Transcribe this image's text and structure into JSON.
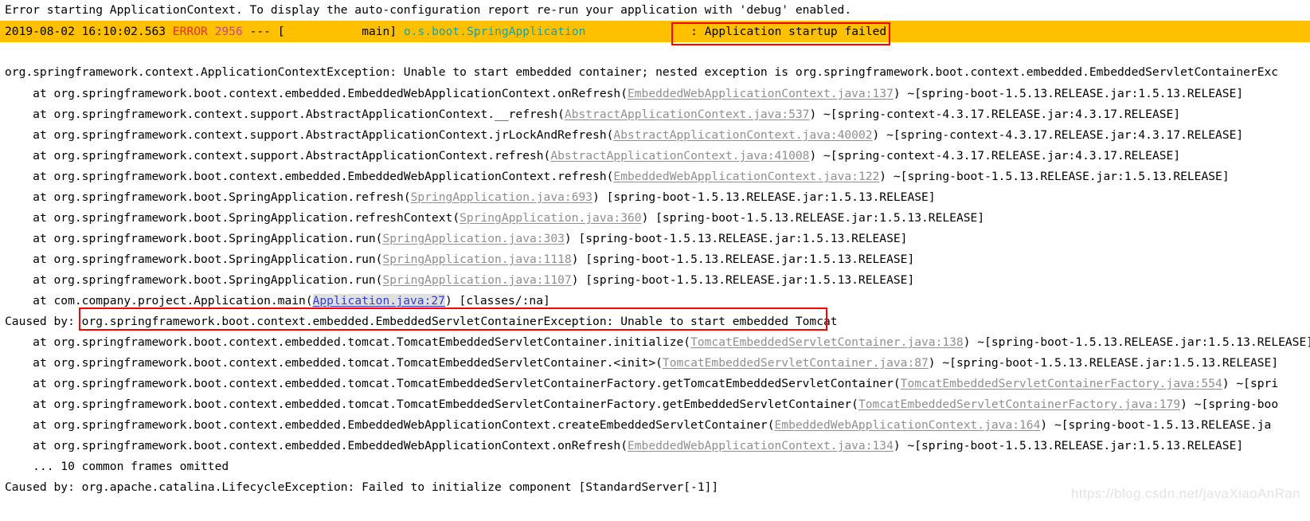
{
  "window": {
    "type": "console-log-output",
    "background_color": "#ffffff",
    "text_color": "#000000",
    "banner_color": "#ffc000",
    "annotation_color": "#ff0000",
    "link_color": "#8f8f8f",
    "link_active_color": "#2a3fd4"
  },
  "header": {
    "message": "Error starting ApplicationContext. To display the auto-configuration report re-run your application with 'debug' enabled."
  },
  "log_entry": {
    "timestamp": "2019-08-02 16:10:02.563",
    "level": "ERROR",
    "pid": "2956",
    "separator": "---",
    "thread_open": "[",
    "thread": "main]",
    "logger": "o.s.boot.SpringApplication",
    "message": ": Application startup failed"
  },
  "annotations": [
    {
      "id": "startup-failed-box",
      "label": ": Application startup failed"
    },
    {
      "id": "embedded-tomcat-box",
      "label": "org.springframework.boot.context.embedded.EmbeddedServletContainerException: Unable to start embedded Tomcat"
    }
  ],
  "exception_header": "org.springframework.context.ApplicationContextException: Unable to start embedded container; nested exception is org.springframework.boot.context.embedded.EmbeddedServletContainerExc",
  "stack_lines": [
    {
      "indent": "    ",
      "prefix": "at org.springframework.boot.context.embedded.EmbeddedWebApplicationContext.onRefresh(",
      "link": "EmbeddedWebApplicationContext.java:137",
      "suffix": ") ~[spring-boot-1.5.13.RELEASE.jar:1.5.13.RELEASE]"
    },
    {
      "indent": "    ",
      "prefix": "at org.springframework.context.support.AbstractApplicationContext.__refresh(",
      "link": "AbstractApplicationContext.java:537",
      "suffix": ") ~[spring-context-4.3.17.RELEASE.jar:4.3.17.RELEASE]"
    },
    {
      "indent": "    ",
      "prefix": "at org.springframework.context.support.AbstractApplicationContext.jrLockAndRefresh(",
      "link": "AbstractApplicationContext.java:40002",
      "suffix": ") ~[spring-context-4.3.17.RELEASE.jar:4.3.17.RELEASE]"
    },
    {
      "indent": "    ",
      "prefix": "at org.springframework.context.support.AbstractApplicationContext.refresh(",
      "link": "AbstractApplicationContext.java:41008",
      "suffix": ") ~[spring-context-4.3.17.RELEASE.jar:4.3.17.RELEASE]"
    },
    {
      "indent": "    ",
      "prefix": "at org.springframework.boot.context.embedded.EmbeddedWebApplicationContext.refresh(",
      "link": "EmbeddedWebApplicationContext.java:122",
      "suffix": ") ~[spring-boot-1.5.13.RELEASE.jar:1.5.13.RELEASE]"
    },
    {
      "indent": "    ",
      "prefix": "at org.springframework.boot.SpringApplication.refresh(",
      "link": "SpringApplication.java:693",
      "suffix": ") [spring-boot-1.5.13.RELEASE.jar:1.5.13.RELEASE]"
    },
    {
      "indent": "    ",
      "prefix": "at org.springframework.boot.SpringApplication.refreshContext(",
      "link": "SpringApplication.java:360",
      "suffix": ") [spring-boot-1.5.13.RELEASE.jar:1.5.13.RELEASE]"
    },
    {
      "indent": "    ",
      "prefix": "at org.springframework.boot.SpringApplication.run(",
      "link": "SpringApplication.java:303",
      "suffix": ") [spring-boot-1.5.13.RELEASE.jar:1.5.13.RELEASE]"
    },
    {
      "indent": "    ",
      "prefix": "at org.springframework.boot.SpringApplication.run(",
      "link": "SpringApplication.java:1118",
      "suffix": ") [spring-boot-1.5.13.RELEASE.jar:1.5.13.RELEASE]"
    },
    {
      "indent": "    ",
      "prefix": "at org.springframework.boot.SpringApplication.run(",
      "link": "SpringApplication.java:1107",
      "suffix": ") [spring-boot-1.5.13.RELEASE.jar:1.5.13.RELEASE]"
    }
  ],
  "selected_line": {
    "indent": "    ",
    "prefix": "at com.company.project.Application.main(",
    "link_part1": "Application.",
    "link_part2": "java:27",
    "suffix": ") [classes/:na]"
  },
  "caused_by_1": {
    "label": "Caused by: ",
    "message": "org.springframework.boot.context.embedded.EmbeddedServletContainerException: Unable to start embedded Tomcat"
  },
  "stack_lines_2": [
    {
      "indent": "    ",
      "prefix": "at org.springframework.boot.context.embedded.tomcat.TomcatEmbeddedServletContainer.initialize(",
      "link": "TomcatEmbeddedServletContainer.java:138",
      "suffix": ") ~[spring-boot-1.5.13.RELEASE.jar:1.5.13.RELEASE]"
    },
    {
      "indent": "    ",
      "prefix": "at org.springframework.boot.context.embedded.tomcat.TomcatEmbeddedServletContainer.<init>(",
      "link": "TomcatEmbeddedServletContainer.java:87",
      "suffix": ") ~[spring-boot-1.5.13.RELEASE.jar:1.5.13.RELEASE]"
    },
    {
      "indent": "    ",
      "prefix": "at org.springframework.boot.context.embedded.tomcat.TomcatEmbeddedServletContainerFactory.getTomcatEmbeddedServletContainer(",
      "link": "TomcatEmbeddedServletContainerFactory.java:554",
      "suffix": ") ~[spri"
    },
    {
      "indent": "    ",
      "prefix": "at org.springframework.boot.context.embedded.tomcat.TomcatEmbeddedServletContainerFactory.getEmbeddedServletContainer(",
      "link": "TomcatEmbeddedServletContainerFactory.java:179",
      "suffix": ") ~[spring-boo"
    },
    {
      "indent": "    ",
      "prefix": "at org.springframework.boot.context.embedded.EmbeddedWebApplicationContext.createEmbeddedServletContainer(",
      "link": "EmbeddedWebApplicationContext.java:164",
      "suffix": ") ~[spring-boot-1.5.13.RELEASE.ja"
    },
    {
      "indent": "    ",
      "prefix": "at org.springframework.boot.context.embedded.EmbeddedWebApplicationContext.onRefresh(",
      "link": "EmbeddedWebApplicationContext.java:134",
      "suffix": ") ~[spring-boot-1.5.13.RELEASE.jar:1.5.13.RELEASE]"
    }
  ],
  "omitted_frames": "    ... 10 common frames omitted",
  "caused_by_2": {
    "label": "Caused by: ",
    "message": "org.apache.catalina.LifecycleException: Failed to initialize component [StandardServer[-1]]"
  },
  "watermark": "https://blog.csdn.net/javaXiaoAnRan"
}
